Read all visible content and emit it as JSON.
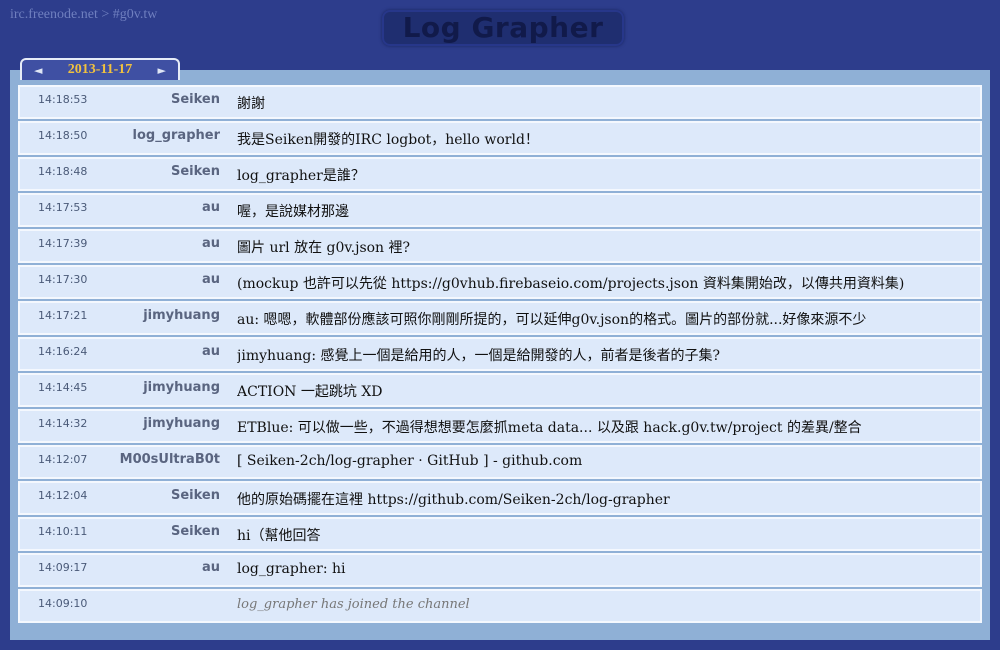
{
  "breadcrumb": "irc.freenode.net > #g0v.tw",
  "app_title": "Log Grapher",
  "date_nav": {
    "date": "2013-11-17",
    "prev_symbol": "◄",
    "next_symbol": "►"
  },
  "messages": [
    {
      "time": "14:18:53",
      "nick": "Seiken",
      "text": "謝謝"
    },
    {
      "time": "14:18:50",
      "nick": "log_grapher",
      "text": "我是Seiken開發的IRC logbot，hello world！"
    },
    {
      "time": "14:18:48",
      "nick": "Seiken",
      "text": "log_grapher是誰？"
    },
    {
      "time": "14:17:53",
      "nick": "au",
      "text": "喔，是說媒材那邊"
    },
    {
      "time": "14:17:39",
      "nick": "au",
      "text": "圖片 url 放在 g0v.json 裡?"
    },
    {
      "time": "14:17:30",
      "nick": "au",
      "text": "(mockup 也許可以先從 https://g0vhub.firebaseio.com/projects.json 資料集開始改，以傳共用資料集)"
    },
    {
      "time": "14:17:21",
      "nick": "jimyhuang",
      "text": "au: 嗯嗯，軟體部份應該可照你剛剛所提的，可以延伸g0v.json的格式。圖片的部份就...好像來源不少"
    },
    {
      "time": "14:16:24",
      "nick": "au",
      "text": "jimyhuang: 感覺上一個是給用的人，一個是給開發的人，前者是後者的子集?"
    },
    {
      "time": "14:14:45",
      "nick": "jimyhuang",
      "text": "ACTION 一起跳坑 XD"
    },
    {
      "time": "14:14:32",
      "nick": "jimyhuang",
      "text": "ETBlue: 可以做一些，不過得想想要怎麼抓meta data... 以及跟 hack.g0v.tw/project 的差異/整合"
    },
    {
      "time": "14:12:07",
      "nick": "M00sUltraB0t",
      "text": "[ Seiken-2ch/log-grapher · GitHub ] - github.com"
    },
    {
      "time": "14:12:04",
      "nick": "Seiken",
      "text": "他的原始碼擺在這裡 https://github.com/Seiken-2ch/log-grapher"
    },
    {
      "time": "14:10:11",
      "nick": "Seiken",
      "text": "hi（幫他回答"
    },
    {
      "time": "14:09:17",
      "nick": "au",
      "text": "log_grapher: hi"
    },
    {
      "time": "14:09:10",
      "nick": "",
      "text": "log_grapher has joined the channel",
      "system": true
    }
  ]
}
